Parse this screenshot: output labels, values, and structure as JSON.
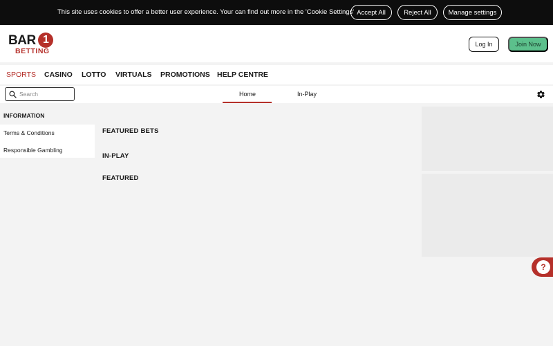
{
  "cookie_bar": {
    "text": "This site uses cookies to offer a better user experience. Your can find out more in the 'Cookie Settings'",
    "accept_label": "Accept All",
    "reject_label": "Reject All",
    "manage_label": "Manage settings"
  },
  "header": {
    "logo": {
      "bar": "BAR",
      "one": "1",
      "betting": "BETTING"
    },
    "login_label": "Log In",
    "join_label": "Join Now"
  },
  "mainnav": {
    "items": [
      {
        "label": "SPORTS",
        "active": true
      },
      {
        "label": "CASINO"
      },
      {
        "label": "LOTTO"
      },
      {
        "label": "VIRTUALS"
      },
      {
        "label": "PROMOTIONS"
      },
      {
        "label": "HELP CENTRE"
      }
    ]
  },
  "subnav": {
    "search_placeholder": "Search",
    "tabs": [
      {
        "label": "Home",
        "active": true
      },
      {
        "label": "In-Play"
      }
    ]
  },
  "information": {
    "heading": "INFORMATION",
    "links": [
      "Terms & Conditions",
      "Responsible Gambling"
    ]
  },
  "sections": [
    "FEATURED BETS",
    "IN-PLAY",
    "FEATURED"
  ],
  "help": {
    "label": "?"
  },
  "colors": {
    "brand_red": "#b5302a",
    "join_green": "#5cc08c",
    "cookie_bg": "#0d0d0d",
    "page_bg": "#f3f3f3"
  }
}
